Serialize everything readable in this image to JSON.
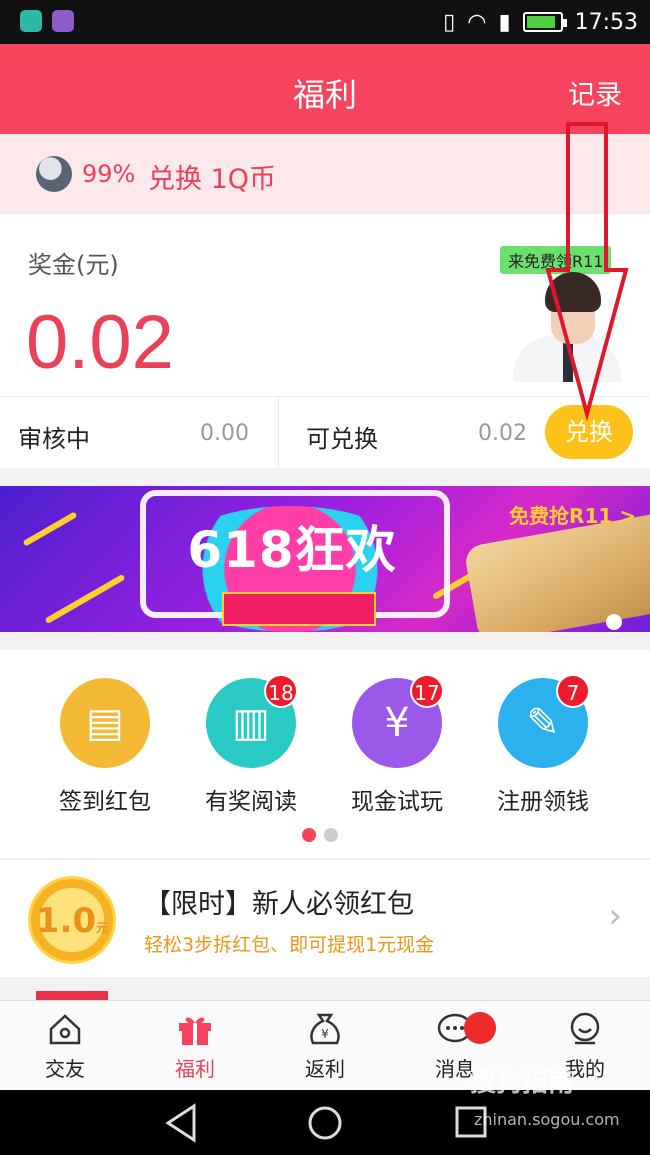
{
  "status_bar": {
    "time": "17:53"
  },
  "header": {
    "title": "福利",
    "record": "记录"
  },
  "notice": {
    "percent": "99%",
    "text": "兑换 1Q币"
  },
  "bonus": {
    "label": "奖金(元)",
    "amount": "0.02",
    "ad_tag": "来免费领R11"
  },
  "stats": {
    "reviewing_label": "审核中",
    "reviewing_value": "0.00",
    "exchangeable_label": "可兑换",
    "exchangeable_value": "0.02",
    "exchange_button": "兑换"
  },
  "banner": {
    "headline": "618狂欢",
    "promo": "免费抢R11 >"
  },
  "shortcuts": [
    {
      "label": "签到红包",
      "badge": "",
      "color": "#f4b935",
      "icon": "calendar-icon"
    },
    {
      "label": "有奖阅读",
      "badge": "18",
      "color": "#29c9c4",
      "icon": "book-icon"
    },
    {
      "label": "现金试玩",
      "badge": "17",
      "color": "#9a59e9",
      "icon": "yuan-icon"
    },
    {
      "label": "注册领钱",
      "badge": "7",
      "color": "#2bb1ee",
      "icon": "pencil-icon"
    }
  ],
  "promo_item": {
    "coin_value": "1.0",
    "coin_unit": "元",
    "title": "【限时】新人必领红包",
    "subtitle": "轻松3步拆红包、即可提现1元现金"
  },
  "nav": [
    {
      "label": "交友",
      "icon": "home-icon"
    },
    {
      "label": "福利",
      "icon": "gift-icon"
    },
    {
      "label": "返利",
      "icon": "money-bag-icon"
    },
    {
      "label": "消息",
      "icon": "chat-icon"
    },
    {
      "label": "我的",
      "icon": "profile-icon"
    }
  ],
  "watermark": {
    "brand": "搜狗指南",
    "url": "zhinan.sogou.com"
  },
  "colors": {
    "brand": "#f6445e",
    "accent": "#ffc21a",
    "badge": "#ee1b2b"
  }
}
